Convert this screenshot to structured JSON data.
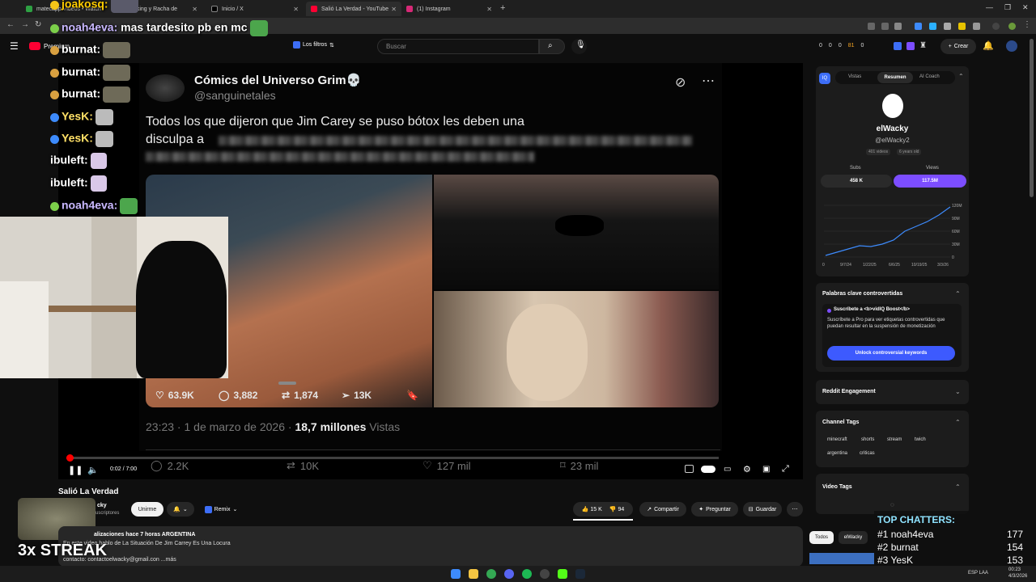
{
  "browser": {
    "tabs": [
      {
        "label": "matecapp Videos • Watch",
        "color": "#2ea043"
      },
      {
        "label": "Ranking y Racha de",
        "color": "#7b61ff"
      },
      {
        "label": "Inicio / X",
        "color": "#000000"
      },
      {
        "label": "Salió La Verdad - YouTube",
        "color": "#ff0033"
      },
      {
        "label": "(1) Instagram",
        "color": "#d62976"
      }
    ],
    "new_tab": "+",
    "window_controls": [
      "—",
      "❐",
      "✕"
    ]
  },
  "youtube": {
    "logo_text": "Premium",
    "filters_label": "Los filtros",
    "search_placeholder": "Buscar",
    "create_label": "Crear",
    "header_stats": [
      "0",
      "0",
      "0",
      "81",
      "0"
    ]
  },
  "tweet": {
    "name": "Cómics del Universo Grim💀",
    "handle": "@sanguinetales",
    "text_line1": "Todos los que dijeron que Jim Carey se puso bótox les deben una",
    "text_line2": "disculpa a",
    "likes": "63.9K",
    "replies": "3,882",
    "retweets": "1,874",
    "views_metric": "13K",
    "timestamp": "23:23 · 1 de marzo de 2026 · ",
    "views_count": "18,7 millones",
    "views_label": "Vistas",
    "bottom_replies": "2.2K",
    "bottom_retweets": "10K",
    "bottom_likes": "127 mil",
    "bottom_bookmarks": "23 mil"
  },
  "player": {
    "time": "0:02 / 7:00",
    "progress": 0.005
  },
  "video": {
    "title": "Salió La Verdad",
    "channel": "cky",
    "subscribers": "uscriptores",
    "subscribe_label": "Unirme",
    "remix_label": "Remix",
    "likes": "15 K",
    "dislikes": "94",
    "share_label": "Compartir",
    "ask_label": "Preguntar",
    "save_label": "Guardar",
    "desc_meta": "alizaciones  hace 7 horas  ARGENTINA",
    "desc_line1": "En este video hablo de La Situación De Jim Carrey Es Una Locura",
    "desc_line2": "contacto: contactoelwacky@gmail.con  ...más"
  },
  "chat": [
    {
      "user": "joakosq:",
      "text": "",
      "color": "#ffcc00"
    },
    {
      "user": "noah4eva:",
      "text": "mas tardesito pb en mc",
      "color": "#c9b8ff"
    },
    {
      "user": "burnat:",
      "text": "",
      "color": "#ffffff"
    },
    {
      "user": "burnat:",
      "text": "",
      "color": "#ffffff"
    },
    {
      "user": "burnat:",
      "text": "",
      "color": "#ffffff"
    },
    {
      "user": "YesK:",
      "text": "",
      "color": "#ffe066"
    },
    {
      "user": "YesK:",
      "text": "",
      "color": "#ffe066"
    },
    {
      "user": "ibuleft:",
      "text": "",
      "color": "#ffffff"
    },
    {
      "user": "ibuleft:",
      "text": "",
      "color": "#ffffff"
    },
    {
      "user": "noah4eva:",
      "text": "",
      "color": "#c9b8ff"
    }
  ],
  "vidiq": {
    "tabs": [
      "Vistas",
      "Resumen",
      "AI Coach"
    ],
    "active_tab": "Resumen",
    "channel_name": "elWacky",
    "channel_handle": "@elWacky2",
    "videos": "401 videos",
    "age": "6 years old",
    "subs_label": "Subs",
    "subs_value": "458 K",
    "views_label": "Views",
    "views_value": "117.5M",
    "chart_y": [
      "120M",
      "90M",
      "60M",
      "30M",
      "0"
    ],
    "chart_x": [
      "0",
      "9/7/24",
      "1/22/25",
      "6/6/25",
      "10/19/25",
      "3/3/26"
    ],
    "controversial_title": "Palabras clave controvertidas",
    "boost_title": "Suscríbete a <b>vidIQ Boost</b>",
    "boost_text": "Suscríbete a Pro para ver etiquetas controvertidas que puedan resultar en la suspensión de monetización",
    "unlock_label": "Unlock controversial keywords",
    "reddit_title": "Reddit Engagement",
    "channel_tags_title": "Channel Tags",
    "channel_tags": [
      "minecraft",
      "shorts",
      "stream",
      "twich",
      "argentina",
      "criticas"
    ],
    "video_tags_title": "Video Tags",
    "bottom_chips": [
      "Todos",
      "elWacky"
    ]
  },
  "overlay": {
    "streak": "3x STREAK",
    "top_chatters_title": "TOP CHATTERS:",
    "top_chatters": [
      {
        "rank": "#1",
        "name": "noah4eva",
        "count": "177"
      },
      {
        "rank": "#2",
        "name": "burnat",
        "count": "154"
      },
      {
        "rank": "#3",
        "name": "YesK",
        "count": "153"
      }
    ]
  },
  "taskbar": {
    "lang": "ESP\nLAA",
    "time": "00:23",
    "date": "4/3/2026"
  }
}
